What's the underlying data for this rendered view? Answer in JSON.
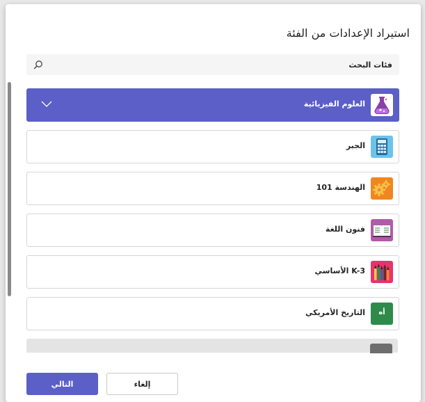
{
  "dialog": {
    "title": "استيراد الإعدادات من الفئة"
  },
  "search": {
    "placeholder": "فئات البحث"
  },
  "categories": [
    {
      "label": "العلوم الفيزيائية",
      "icon": "flask-icon",
      "selected": true
    },
    {
      "label": "الجبر",
      "icon": "calculator-icon",
      "selected": false
    },
    {
      "label": "الهندسة 101",
      "icon": "gears-icon",
      "selected": false
    },
    {
      "label": "فنون اللغة",
      "icon": "book-icon",
      "selected": false
    },
    {
      "label": "K-3 الأساسي",
      "icon": "pencils-icon",
      "selected": false
    },
    {
      "label": "التاريخ الأمريكي",
      "icon": "letter-tile-icon",
      "tile_text": "أه",
      "selected": false
    }
  ],
  "buttons": {
    "next": "التالي",
    "cancel": "إلغاء"
  },
  "colors": {
    "accent": "#5b5fc7",
    "history_tile": "#2e8b4a"
  }
}
